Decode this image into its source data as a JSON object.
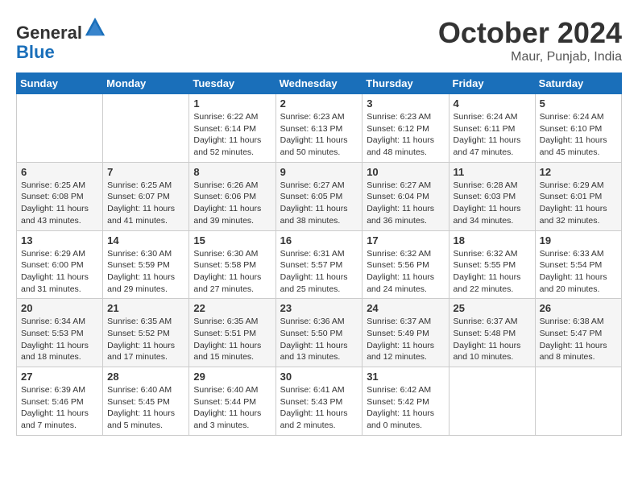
{
  "header": {
    "logo_general": "General",
    "logo_blue": "Blue",
    "month_title": "October 2024",
    "location": "Maur, Punjab, India"
  },
  "weekdays": [
    "Sunday",
    "Monday",
    "Tuesday",
    "Wednesday",
    "Thursday",
    "Friday",
    "Saturday"
  ],
  "weeks": [
    [
      {
        "day": "",
        "info": ""
      },
      {
        "day": "",
        "info": ""
      },
      {
        "day": "1",
        "info": "Sunrise: 6:22 AM\nSunset: 6:14 PM\nDaylight: 11 hours and 52 minutes."
      },
      {
        "day": "2",
        "info": "Sunrise: 6:23 AM\nSunset: 6:13 PM\nDaylight: 11 hours and 50 minutes."
      },
      {
        "day": "3",
        "info": "Sunrise: 6:23 AM\nSunset: 6:12 PM\nDaylight: 11 hours and 48 minutes."
      },
      {
        "day": "4",
        "info": "Sunrise: 6:24 AM\nSunset: 6:11 PM\nDaylight: 11 hours and 47 minutes."
      },
      {
        "day": "5",
        "info": "Sunrise: 6:24 AM\nSunset: 6:10 PM\nDaylight: 11 hours and 45 minutes."
      }
    ],
    [
      {
        "day": "6",
        "info": "Sunrise: 6:25 AM\nSunset: 6:08 PM\nDaylight: 11 hours and 43 minutes."
      },
      {
        "day": "7",
        "info": "Sunrise: 6:25 AM\nSunset: 6:07 PM\nDaylight: 11 hours and 41 minutes."
      },
      {
        "day": "8",
        "info": "Sunrise: 6:26 AM\nSunset: 6:06 PM\nDaylight: 11 hours and 39 minutes."
      },
      {
        "day": "9",
        "info": "Sunrise: 6:27 AM\nSunset: 6:05 PM\nDaylight: 11 hours and 38 minutes."
      },
      {
        "day": "10",
        "info": "Sunrise: 6:27 AM\nSunset: 6:04 PM\nDaylight: 11 hours and 36 minutes."
      },
      {
        "day": "11",
        "info": "Sunrise: 6:28 AM\nSunset: 6:03 PM\nDaylight: 11 hours and 34 minutes."
      },
      {
        "day": "12",
        "info": "Sunrise: 6:29 AM\nSunset: 6:01 PM\nDaylight: 11 hours and 32 minutes."
      }
    ],
    [
      {
        "day": "13",
        "info": "Sunrise: 6:29 AM\nSunset: 6:00 PM\nDaylight: 11 hours and 31 minutes."
      },
      {
        "day": "14",
        "info": "Sunrise: 6:30 AM\nSunset: 5:59 PM\nDaylight: 11 hours and 29 minutes."
      },
      {
        "day": "15",
        "info": "Sunrise: 6:30 AM\nSunset: 5:58 PM\nDaylight: 11 hours and 27 minutes."
      },
      {
        "day": "16",
        "info": "Sunrise: 6:31 AM\nSunset: 5:57 PM\nDaylight: 11 hours and 25 minutes."
      },
      {
        "day": "17",
        "info": "Sunrise: 6:32 AM\nSunset: 5:56 PM\nDaylight: 11 hours and 24 minutes."
      },
      {
        "day": "18",
        "info": "Sunrise: 6:32 AM\nSunset: 5:55 PM\nDaylight: 11 hours and 22 minutes."
      },
      {
        "day": "19",
        "info": "Sunrise: 6:33 AM\nSunset: 5:54 PM\nDaylight: 11 hours and 20 minutes."
      }
    ],
    [
      {
        "day": "20",
        "info": "Sunrise: 6:34 AM\nSunset: 5:53 PM\nDaylight: 11 hours and 18 minutes."
      },
      {
        "day": "21",
        "info": "Sunrise: 6:35 AM\nSunset: 5:52 PM\nDaylight: 11 hours and 17 minutes."
      },
      {
        "day": "22",
        "info": "Sunrise: 6:35 AM\nSunset: 5:51 PM\nDaylight: 11 hours and 15 minutes."
      },
      {
        "day": "23",
        "info": "Sunrise: 6:36 AM\nSunset: 5:50 PM\nDaylight: 11 hours and 13 minutes."
      },
      {
        "day": "24",
        "info": "Sunrise: 6:37 AM\nSunset: 5:49 PM\nDaylight: 11 hours and 12 minutes."
      },
      {
        "day": "25",
        "info": "Sunrise: 6:37 AM\nSunset: 5:48 PM\nDaylight: 11 hours and 10 minutes."
      },
      {
        "day": "26",
        "info": "Sunrise: 6:38 AM\nSunset: 5:47 PM\nDaylight: 11 hours and 8 minutes."
      }
    ],
    [
      {
        "day": "27",
        "info": "Sunrise: 6:39 AM\nSunset: 5:46 PM\nDaylight: 11 hours and 7 minutes."
      },
      {
        "day": "28",
        "info": "Sunrise: 6:40 AM\nSunset: 5:45 PM\nDaylight: 11 hours and 5 minutes."
      },
      {
        "day": "29",
        "info": "Sunrise: 6:40 AM\nSunset: 5:44 PM\nDaylight: 11 hours and 3 minutes."
      },
      {
        "day": "30",
        "info": "Sunrise: 6:41 AM\nSunset: 5:43 PM\nDaylight: 11 hours and 2 minutes."
      },
      {
        "day": "31",
        "info": "Sunrise: 6:42 AM\nSunset: 5:42 PM\nDaylight: 11 hours and 0 minutes."
      },
      {
        "day": "",
        "info": ""
      },
      {
        "day": "",
        "info": ""
      }
    ]
  ]
}
